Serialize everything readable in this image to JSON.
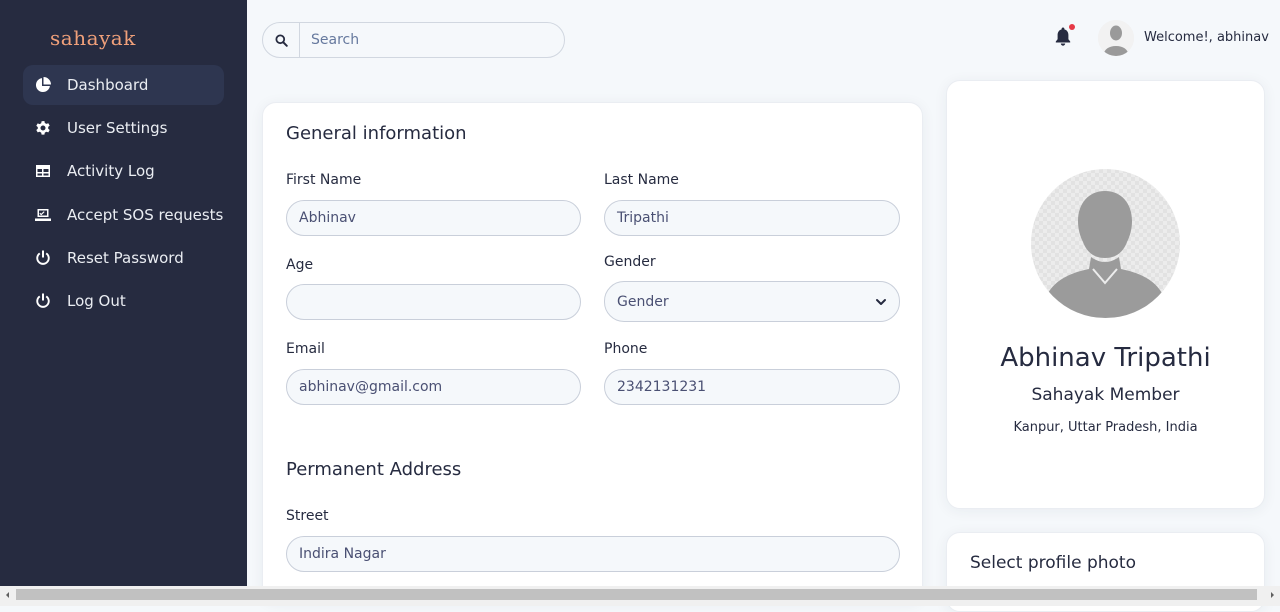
{
  "brand": {
    "name": "sahayak"
  },
  "sidebar": {
    "items": [
      {
        "label": "Dashboard",
        "icon": "pie-chart-icon",
        "active": true
      },
      {
        "label": "User Settings",
        "icon": "gear-icon"
      },
      {
        "label": "Activity Log",
        "icon": "table-icon"
      },
      {
        "label": "Accept SOS requests",
        "icon": "laptop-check-icon"
      },
      {
        "label": "Reset Password",
        "icon": "power-icon"
      },
      {
        "label": "Log Out",
        "icon": "power-icon"
      }
    ]
  },
  "search": {
    "placeholder": "Search",
    "value": ""
  },
  "header": {
    "welcome": "Welcome!, abhinav",
    "notification_dot_color": "#e63946"
  },
  "general": {
    "title": "General information",
    "first_name_label": "First Name",
    "first_name_value": "Abhinav",
    "last_name_label": "Last Name",
    "last_name_value": "Tripathi",
    "age_label": "Age",
    "age_value": "",
    "gender_label": "Gender",
    "gender_value": "Gender",
    "email_label": "Email",
    "email_value": "abhinav@gmail.com",
    "phone_label": "Phone",
    "phone_value": "2342131231"
  },
  "address": {
    "title": "Permanent Address",
    "street_label": "Street",
    "street_value": "Indira Nagar"
  },
  "profile": {
    "name": "Abhinav Tripathi",
    "role": "Sahayak Member",
    "location": "Kanpur, Uttar Pradesh, India"
  },
  "photo": {
    "title": "Select profile photo"
  },
  "colors": {
    "sidebar_bg": "#262b40",
    "brand": "#f0a07a",
    "page_bg": "#f5f8fb"
  }
}
